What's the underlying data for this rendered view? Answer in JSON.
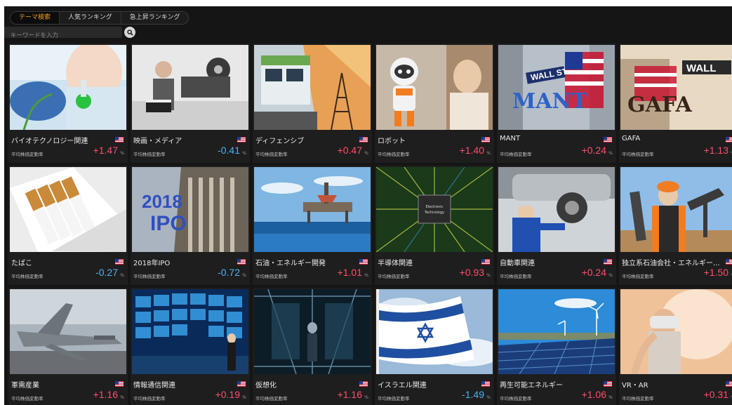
{
  "tabs": [
    {
      "label": "テーマ検索",
      "active": true
    },
    {
      "label": "人気ランキング",
      "active": false
    },
    {
      "label": "急上昇ランキング",
      "active": false
    }
  ],
  "search": {
    "placeholder": "キーワードを入力",
    "icon": "search-icon"
  },
  "metric_label": "平均株価変動率",
  "unit": "%",
  "themes": [
    {
      "title": "バイオテクノロジー関連",
      "change": "+1.47",
      "direction": "up"
    },
    {
      "title": "映画・メディア",
      "change": "-0.41",
      "direction": "down"
    },
    {
      "title": "ディフェンシブ",
      "change": "+0.47",
      "direction": "up"
    },
    {
      "title": "ロボット",
      "change": "+1.40",
      "direction": "up"
    },
    {
      "title": "MANT",
      "change": "+0.24",
      "direction": "up",
      "image_text": "WALL ST / MANT"
    },
    {
      "title": "GAFA",
      "change": "+1.13",
      "direction": "up",
      "image_text": "WALL ST / GAFA"
    },
    {
      "title": "たばこ",
      "change": "-0.27",
      "direction": "down"
    },
    {
      "title": "2018年IPO",
      "change": "-0.72",
      "direction": "down",
      "image_text": "2018 IPO"
    },
    {
      "title": "石油・エネルギー開発",
      "change": "+1.01",
      "direction": "up"
    },
    {
      "title": "半導体関連",
      "change": "+0.93",
      "direction": "up",
      "image_text": "Electronic Technology"
    },
    {
      "title": "自動車関連",
      "change": "+0.24",
      "direction": "up"
    },
    {
      "title": "独立系石油会社・エネルギー...",
      "change": "+1.50",
      "direction": "up"
    },
    {
      "title": "軍需産業",
      "change": "+1.16",
      "direction": "up"
    },
    {
      "title": "情報通信関連",
      "change": "+0.19",
      "direction": "up"
    },
    {
      "title": "仮想化",
      "change": "+1.16",
      "direction": "up"
    },
    {
      "title": "イスラエル関連",
      "change": "-1.49",
      "direction": "down"
    },
    {
      "title": "再生可能エネルギー",
      "change": "+1.06",
      "direction": "up"
    },
    {
      "title": "VR・AR",
      "change": "+0.31",
      "direction": "up"
    }
  ],
  "colors": {
    "up": "#ff4d6d",
    "down": "#4db3f0",
    "active_tab": "#f0a020",
    "background": "#151515"
  }
}
